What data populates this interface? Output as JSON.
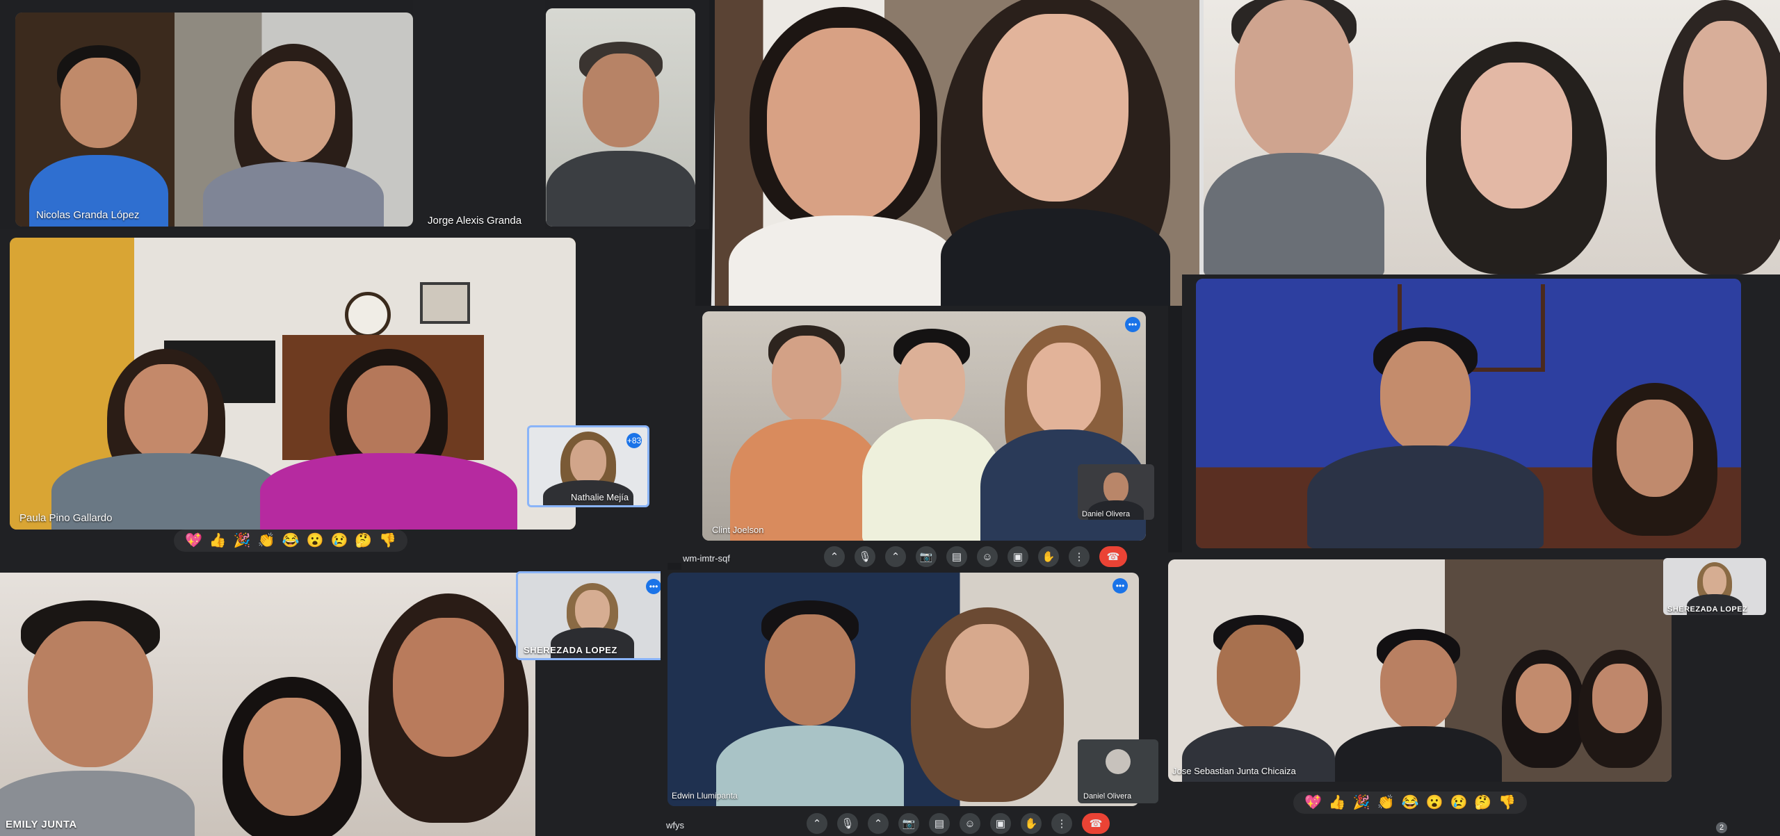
{
  "participants": {
    "nicolas": "Nicolas Granda López",
    "jorge": "Jorge Alexis Granda",
    "paula": "Paula Pino Gallardo",
    "nathalie": "Nathalie Mejía",
    "emily": "EMILY JUNTA",
    "sherezada_a": "SHEREZADA LOPEZ",
    "clint": "Clint Joelson",
    "daniel_a": "Daniel Olivera",
    "edwin": "Edwin Llumipanta",
    "daniel_b": "Daniel Olivera",
    "jose": "Jose Sebastian Junta Chicaiza",
    "sherezada_b": "SHEREZADA LOPEZ"
  },
  "meeting_codes": {
    "a": "wm-imtr-sqf",
    "b": "wfys"
  },
  "badges": {
    "more_count": "+83"
  },
  "reactions": [
    "💖",
    "👍",
    "🎉",
    "👏",
    "😂",
    "😮",
    "😢",
    "🤔",
    "👎"
  ],
  "controls_icons": [
    "chevron-up-icon",
    "mic-icon",
    "chevron-up-icon",
    "camera-icon",
    "captions-icon",
    "emoji-icon",
    "present-icon",
    "raise-hand-icon",
    "more-icon",
    "end-call-icon"
  ],
  "controls_glyphs": [
    "⌃",
    "🎙",
    "⌃",
    "📷",
    "▤",
    "☺",
    "▣",
    "✋",
    "⋮",
    "☎"
  ],
  "colors": {
    "meet_dark": "#202124",
    "end_call": "#ea4335",
    "accent_blue": "#1a73e8"
  },
  "page_number": "2"
}
